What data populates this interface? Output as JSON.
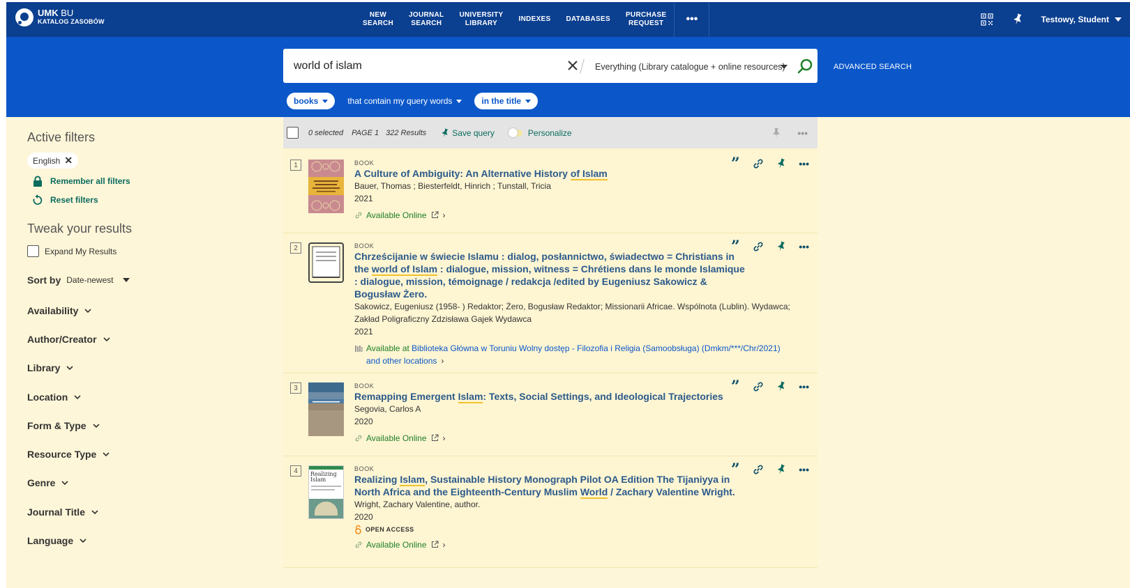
{
  "header": {
    "logo_main": "UMK",
    "logo_main_thin": "BU",
    "logo_sub": "KATALOG ZASOBÓW",
    "nav": [
      {
        "line1": "NEW",
        "line2": "SEARCH"
      },
      {
        "line1": "JOURNAL",
        "line2": "SEARCH"
      },
      {
        "line1": "UNIVERSITY",
        "line2": "LIBRARY"
      },
      {
        "line1": "INDEXES",
        "line2": ""
      },
      {
        "line1": "DATABASES",
        "line2": ""
      },
      {
        "line1": "PURCHASE",
        "line2": "REQUEST"
      }
    ],
    "more": "•••",
    "user": "Testowy, Student"
  },
  "search": {
    "query": "world of islam",
    "scope": "Everything (Library catalogue + online resources)",
    "advanced": "ADVANCED SEARCH",
    "chip_type": "books",
    "chip_match": "that contain my query words",
    "chip_field": "in the title"
  },
  "sidebar": {
    "active_filters_title": "Active filters",
    "active_filter": "English",
    "remember": "Remember all filters",
    "reset": "Reset filters",
    "tweak_title": "Tweak your results",
    "expand": "Expand My Results",
    "sort_label": "Sort by",
    "sort_value": "Date-newest",
    "facets": [
      "Availability",
      "Author/Creator",
      "Library",
      "Location",
      "Form & Type",
      "Resource Type",
      "Genre",
      "Journal Title",
      "Language"
    ]
  },
  "toolbar": {
    "selected": "0 selected",
    "page": "PAGE 1",
    "count": "322 Results",
    "save_query": "Save query",
    "personalize": "Personalize",
    "more": "•••"
  },
  "results": [
    {
      "num": "1",
      "type": "BOOK",
      "title_parts": [
        "A Culture of Ambiguity: An Alternative History ",
        "of Islam",
        ""
      ],
      "authors": "Bauer, Thomas ; Biesterfeldt, Hinrich ; Tunstall, Tricia",
      "year": "2021",
      "availability": "Available Online",
      "open_access": ""
    },
    {
      "num": "2",
      "type": "BOOK",
      "title_line1": "Chrześcijanie w świecie Islamu : dialog, posłannictwo, świadectwo = Christians in",
      "title_line2a": "the ",
      "title_line2b": "world of Islam",
      "title_line2c": " : dialogue, mission, witness = Chrétiens dans le monde Islamique",
      "title_line3": ": dialogue, mission, témoignage / redakcja /edited by Eugeniusz Sakowicz &",
      "title_line4": "Bogusław Żero.",
      "authors": "Sakowicz, Eugeniusz (1958- ) Redaktor; Żero, Bogusław Redaktor; Missionarii Africae. Wspólnota (Lublin). Wydawca; Zakład Poligraficzny Zdzisława Gajek Wydawca",
      "year": "2021",
      "availability": "Available at",
      "location": "Biblioteka Główna w Toruniu  Wolny dostęp - Filozofia i Religia (Samoobsługa) (Dmkm/***/Chr/2021)",
      "other": "and other locations"
    },
    {
      "num": "3",
      "type": "BOOK",
      "title_a": "Remapping Emergent ",
      "title_b": "Islam",
      "title_c": ": Texts, Social Settings, and Ideological Trajectories",
      "authors": "Segovia, Carlos A",
      "year": "2020",
      "availability": "Available Online"
    },
    {
      "num": "4",
      "type": "BOOK",
      "title_l1a": "Realizing ",
      "title_l1b": "Islam",
      "title_l1c": ", Sustainable History Monograph Pilot OA Edition The Tijaniyya in",
      "title_l2a": "North Africa and the Eighteenth-Century Muslim ",
      "title_l2b": "World",
      "title_l2c": " / Zachary Valentine Wright.",
      "authors": "Wright, Zachary Valentine, author.",
      "year": "2020",
      "open_access": "OPEN ACCESS",
      "availability": "Available Online",
      "cover_text": "Realizing Islam"
    }
  ],
  "colors": {
    "topbar": "#0b3f8f",
    "searchband": "#0b57c9",
    "page_bg": "#fef6d8",
    "link_teal": "#0a6b5f",
    "title_blue": "#2b5a8b",
    "available_green": "#1e7f28",
    "highlight": "#f2c22d"
  }
}
